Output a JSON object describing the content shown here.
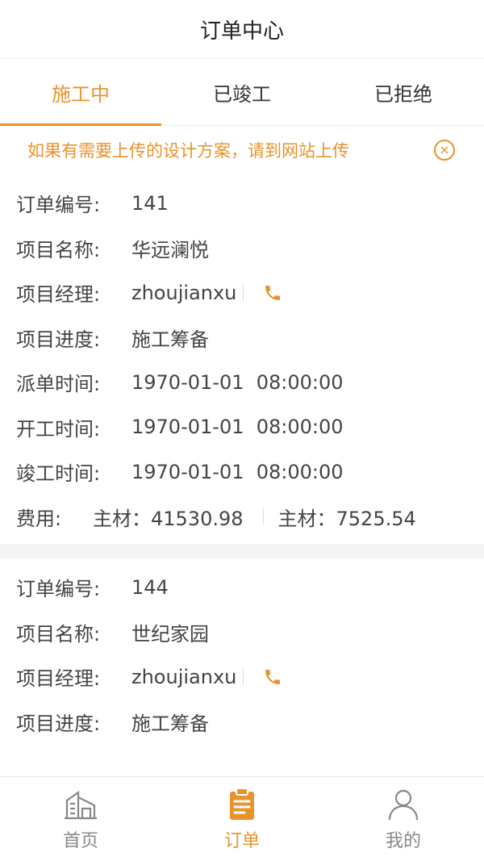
{
  "header": {
    "title": "订单中心"
  },
  "tabs": [
    {
      "label": "施工中"
    },
    {
      "label": "已竣工"
    },
    {
      "label": "已拒绝"
    }
  ],
  "notice": {
    "text": "如果有需要上传的设计方案，请到网站上传",
    "close_symbol": "×"
  },
  "labels": {
    "order_no": "订单编号:",
    "project_name": "项目名称:",
    "project_manager": "项目经理:",
    "progress": "项目进度:",
    "dispatch_time": "派单时间:",
    "start_time": "开工时间:",
    "complete_time": "竣工时间:",
    "fee": "费用:"
  },
  "orders": [
    {
      "order_no": "141",
      "project_name": "华远澜悦",
      "project_manager": "zhoujianxu",
      "progress": "施工筹备",
      "dispatch_time": "1970-01-01  08:00:00",
      "start_time": "1970-01-01  08:00:00",
      "complete_time": "1970-01-01  08:00:00",
      "fee_main": "主材：41530.98",
      "fee_aux": "主材：7525.54"
    },
    {
      "order_no": "144",
      "project_name": "世纪家园",
      "project_manager": "zhoujianxu",
      "progress": "施工筹备"
    }
  ],
  "bottom_nav": [
    {
      "label": "首页",
      "icon": "building-icon"
    },
    {
      "label": "订单",
      "icon": "clipboard-icon"
    },
    {
      "label": "我的",
      "icon": "user-icon"
    }
  ],
  "colors": {
    "accent": "#e8932b",
    "text": "#444444",
    "muted": "#888888"
  }
}
